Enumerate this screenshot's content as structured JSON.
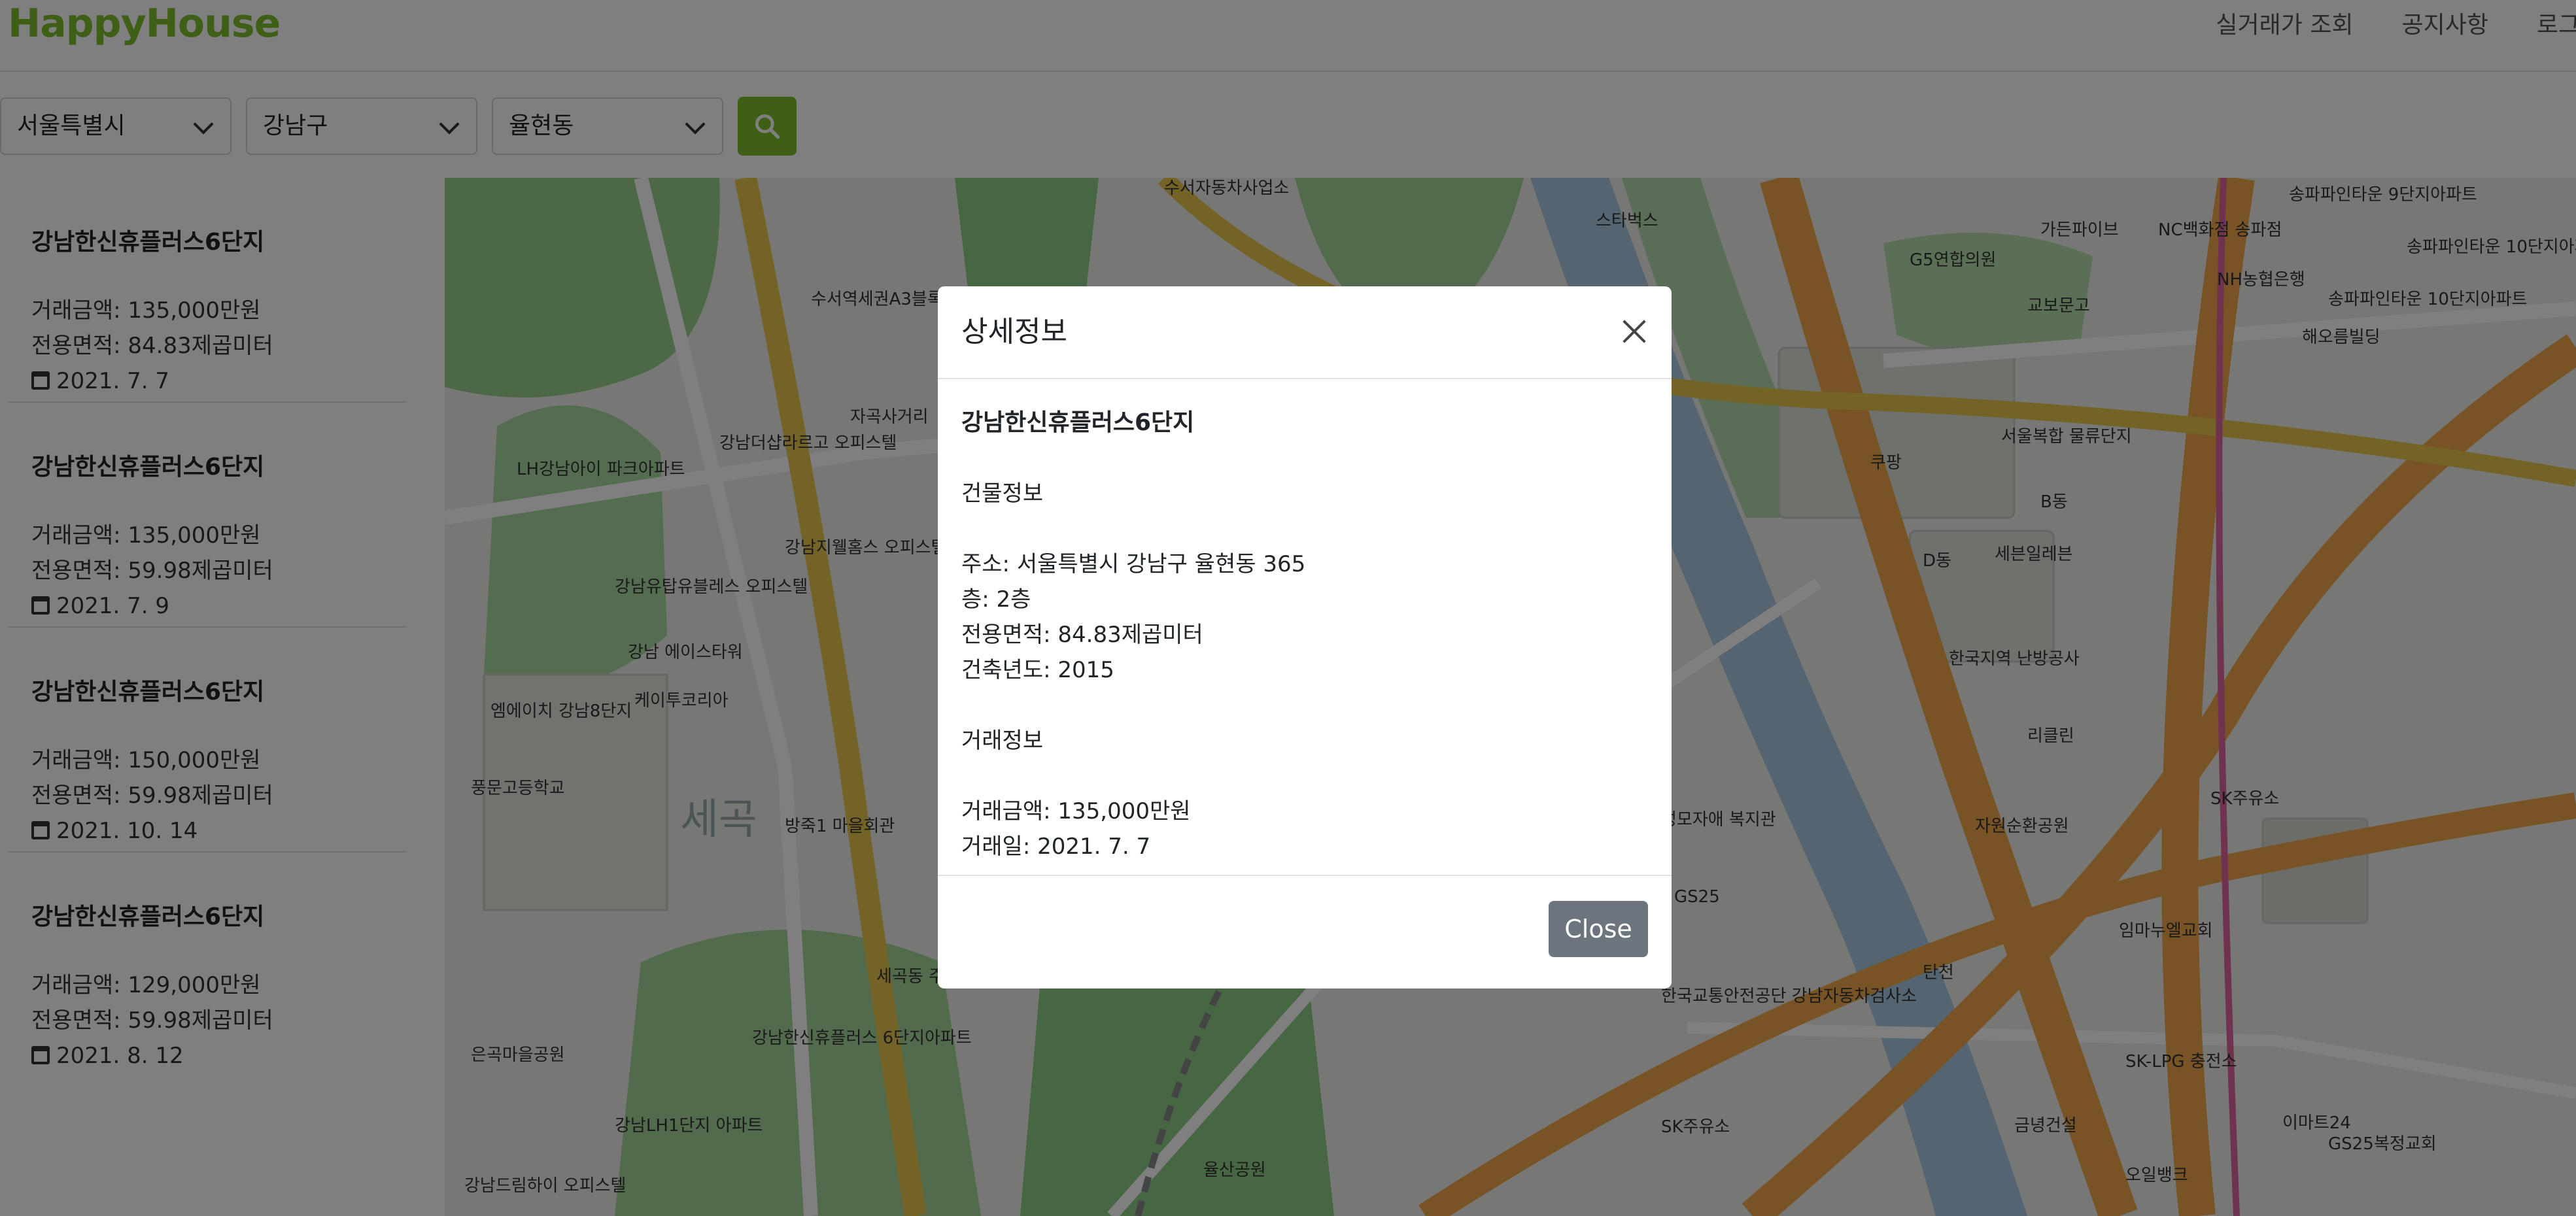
{
  "header": {
    "brand": "HappyHouse",
    "nav": [
      "실거래가 조회",
      "공지사항",
      "로그"
    ]
  },
  "search": {
    "city": "서울특별시",
    "district": "강남구",
    "dong": "율현동"
  },
  "list": [
    {
      "name": "강남한신휴플러스6단지",
      "price": "거래금액: 135,000만원",
      "area": "전용면적: 84.83제곱미터",
      "date": "2021. 7. 7"
    },
    {
      "name": "강남한신휴플러스6단지",
      "price": "거래금액: 135,000만원",
      "area": "전용면적: 59.98제곱미터",
      "date": "2021. 7. 9"
    },
    {
      "name": "강남한신휴플러스6단지",
      "price": "거래금액: 150,000만원",
      "area": "전용면적: 59.98제곱미터",
      "date": "2021. 10. 14"
    },
    {
      "name": "강남한신휴플러스6단지",
      "price": "거래금액: 129,000만원",
      "area": "전용면적: 59.98제곱미터",
      "date": "2021. 8. 12"
    }
  ],
  "map": {
    "labels": [
      "수서자동차사업소",
      "스타벅스",
      "G5연합의원",
      "가든파이브",
      "NC백화점 송파점",
      "NH농협은행",
      "송파파인타운 9단지아파트",
      "송파파인타운 10단지아파트",
      "교보문고",
      "해오름빌딩",
      "송파파인타운 10단지아파트",
      "수서역세권A3블록",
      "강남더샵라르고 오피스텔",
      "자곡사거리",
      "LH강남아이 파크아파트",
      "강남지웰홈스 오피스텔",
      "강남유탑유블레스 오피스텔",
      "강남 에이스타워",
      "케이투코리아",
      "엠에이치 강남8단지",
      "풍문고등학교",
      "방죽1 마을회관",
      "세곡",
      "세곡동 주민센터",
      "은곡마을공원",
      "강남LH1단지 아파트",
      "강남드림하이 오피스텔",
      "강남한신휴플러스 6단지아파트",
      "쿠팡",
      "서울복합 물류단지",
      "B동",
      "세븐일레븐",
      "D동",
      "한국지역 난방공사",
      "리클린",
      "성모자애 복지관",
      "GS25",
      "자원순환공원",
      "SK주유소",
      "임마누엘교회",
      "한국교통안전공단 강남자동차검사소",
      "SK-LPG 충전소",
      "SK주유소",
      "금녕건설",
      "오일뱅크",
      "이마트24",
      "GS25",
      "복정교회",
      "율산공원",
      "탄천"
    ]
  },
  "modal": {
    "title": "상세정보",
    "apt_name": "강남한신휴플러스6단지",
    "building_section": "건물정보",
    "address": "주소: 서울특별시 강남구 율현동 365",
    "floor": "층: 2층",
    "area": "전용면적: 84.83제곱미터",
    "built_year": "건축년도: 2015",
    "deal_section": "거래정보",
    "price": "거래금액: 135,000만원",
    "deal_date": "거래일: 2021. 7. 7",
    "close_label": "Close"
  },
  "colors": {
    "brand": "#7fbf2e",
    "close_button": "#6c757d",
    "road_major": "#f0a64a",
    "park": "#78c27a",
    "river": "#a8c8e0"
  },
  "icons": {
    "search": "search-icon",
    "calendar": "calendar-icon",
    "close": "close-icon",
    "chevron": "chevron-down-icon"
  }
}
